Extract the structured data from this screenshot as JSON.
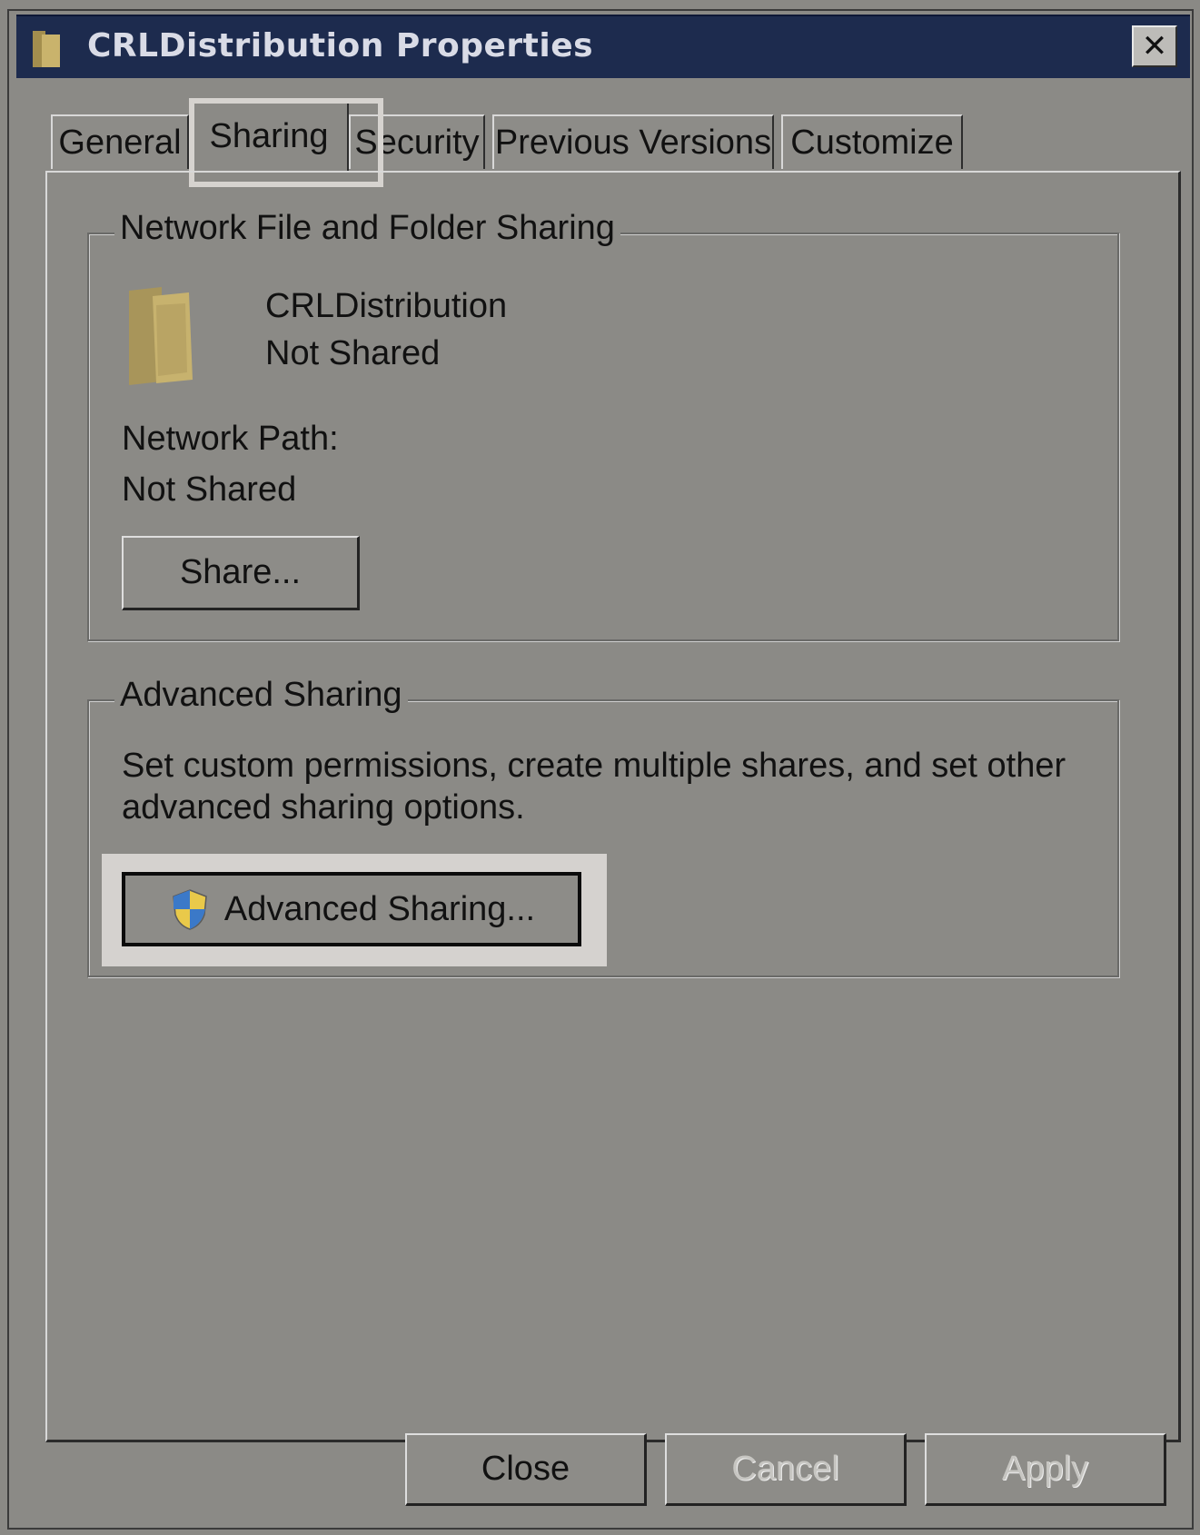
{
  "window": {
    "title": "CRLDistribution Properties",
    "close_label": "✕"
  },
  "tabs": [
    {
      "label": "General"
    },
    {
      "label": "Sharing"
    },
    {
      "label": "Security"
    },
    {
      "label": "Previous Versions"
    },
    {
      "label": "Customize"
    }
  ],
  "network_sharing": {
    "group_label": "Network File and Folder Sharing",
    "folder_name": "CRLDistribution",
    "folder_status": "Not Shared",
    "network_path_label": "Network Path:",
    "network_path_value": "Not Shared",
    "share_button": "Share..."
  },
  "advanced_sharing": {
    "group_label": "Advanced Sharing",
    "description_line1": "Set custom permissions, create multiple shares, and set other",
    "description_line2": "advanced sharing options.",
    "button_label": "Advanced Sharing..."
  },
  "footer": {
    "close": "Close",
    "cancel": "Cancel",
    "apply": "Apply"
  },
  "colors": {
    "titlebar": "#1d2b4e",
    "dialog_bg": "#8b8a86",
    "highlight": "#d5d2cf"
  },
  "icons": {
    "title_icon": "folder-icon",
    "folder_icon": "folder-icon",
    "button_icon": "uac-shield-icon"
  }
}
